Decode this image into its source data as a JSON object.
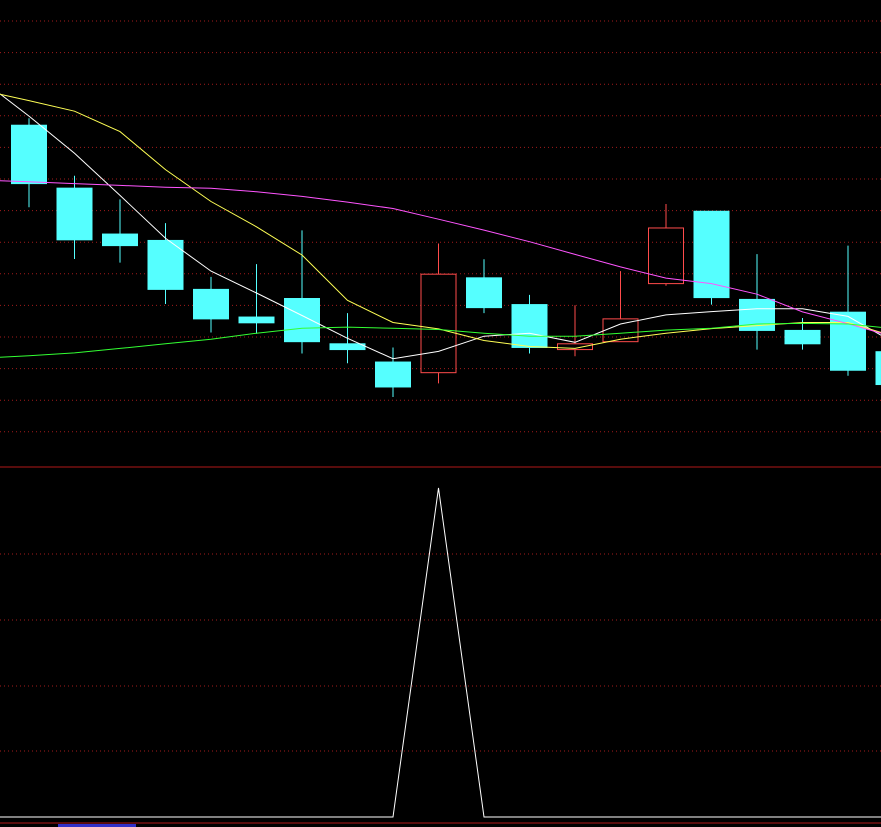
{
  "chart_data": [
    {
      "type": "candlestick",
      "panel": "price",
      "title": "",
      "xlabel": "",
      "ylabel": "",
      "ylim": [
        0,
        100
      ],
      "grid": true,
      "colors": {
        "down": "#55ffff",
        "up": "#ff4b4b",
        "ma_short": "#ffffff",
        "ma_mid": "#ffff55",
        "ma_long": "#ff55ff",
        "ma_extra": "#33ff33",
        "grid": "#c02020",
        "separator": "#b01818",
        "background": "#000000"
      },
      "candles": [
        {
          "open": 89.4,
          "close": 70.2,
          "high": 91.7,
          "low": 62.4
        },
        {
          "open": 68.7,
          "close": 51.7,
          "high": 72.8,
          "low": 45.4
        },
        {
          "open": 53.6,
          "close": 49.8,
          "high": 65.0,
          "low": 44.2
        },
        {
          "open": 51.5,
          "close": 35.4,
          "high": 57.2,
          "low": 30.6
        },
        {
          "open": 35.4,
          "close": 25.7,
          "high": 39.5,
          "low": 21.2
        },
        {
          "open": 26.3,
          "close": 24.4,
          "high": 43.7,
          "low": 20.8
        },
        {
          "open": 32.4,
          "close": 18.2,
          "high": 54.8,
          "low": 14.3
        },
        {
          "open": 17.5,
          "close": 15.6,
          "high": 27.6,
          "low": 11.1
        },
        {
          "open": 11.5,
          "close": 3.3,
          "high": 16.3,
          "low": 0.0
        },
        {
          "open": 8.0,
          "close": 40.4,
          "high": 50.5,
          "low": 4.5
        },
        {
          "open": 39.2,
          "close": 29.4,
          "high": 45.3,
          "low": 27.6
        },
        {
          "open": 30.4,
          "close": 16.3,
          "high": 33.6,
          "low": 14.3
        },
        {
          "open": 15.6,
          "close": 17.5,
          "high": 30.2,
          "low": 13.4
        },
        {
          "open": 18.2,
          "close": 25.7,
          "high": 41.4,
          "low": 18.2
        },
        {
          "open": 37.3,
          "close": 55.6,
          "high": 63.5,
          "low": 36.6
        },
        {
          "open": 61.1,
          "close": 32.7,
          "high": 61.1,
          "low": 30.4
        },
        {
          "open": 32.1,
          "close": 21.9,
          "high": 47.0,
          "low": 15.6
        },
        {
          "open": 21.9,
          "close": 17.5,
          "high": 26.0,
          "low": 15.6
        },
        {
          "open": 27.9,
          "close": 8.8,
          "high": 49.8,
          "low": 7.0
        },
        {
          "open": 14.9,
          "close": 4.1,
          "high": 22.5,
          "low": 0.0
        }
      ],
      "series": [
        {
          "values": [
            92.4,
            80.2,
            66.3,
            52.2,
            41.4,
            34.2,
            26.8,
            19.3,
            12.6,
            15.0,
            20.0,
            21.0,
            18.0,
            24.0,
            27.0,
            28.1,
            29.0,
            29.0,
            26.5,
            18.0
          ]
        },
        {
          "values": [
            97.5,
            94.0,
            87.3,
            74.8,
            64.3,
            56.0,
            46.7,
            31.8,
            24.5,
            22.4,
            18.6,
            16.6,
            16.0,
            19.0,
            21.0,
            22.5,
            23.5,
            24.5,
            24.5,
            20.0
          ]
        },
        {
          "values": [
            70.8,
            70.2,
            69.6,
            69.0,
            68.7,
            67.5,
            66.0,
            64.1,
            62.0,
            58.5,
            54.9,
            51.1,
            46.9,
            42.8,
            39.1,
            37.3,
            33.8,
            28.0,
            24.1,
            19.8
          ]
        },
        {
          "values": [
            13.6,
            14.5,
            16.0,
            17.5,
            19.0,
            21.0,
            22.6,
            23.0,
            22.6,
            22.2,
            21.0,
            20.0,
            20.0,
            21.0,
            22.0,
            22.6,
            24.0,
            24.2,
            24.0,
            22.5
          ]
        }
      ]
    },
    {
      "type": "line",
      "panel": "indicator",
      "title": "",
      "xlabel": "",
      "ylabel": "",
      "ylim": [
        0,
        1
      ],
      "grid": true,
      "colors": {
        "line": "#ffffff"
      },
      "series": [
        {
          "values": [
            0,
            0,
            0,
            0,
            0,
            0,
            0,
            0,
            0,
            1,
            0,
            0,
            0,
            0,
            0,
            0,
            0,
            0,
            0,
            0
          ]
        }
      ]
    }
  ]
}
